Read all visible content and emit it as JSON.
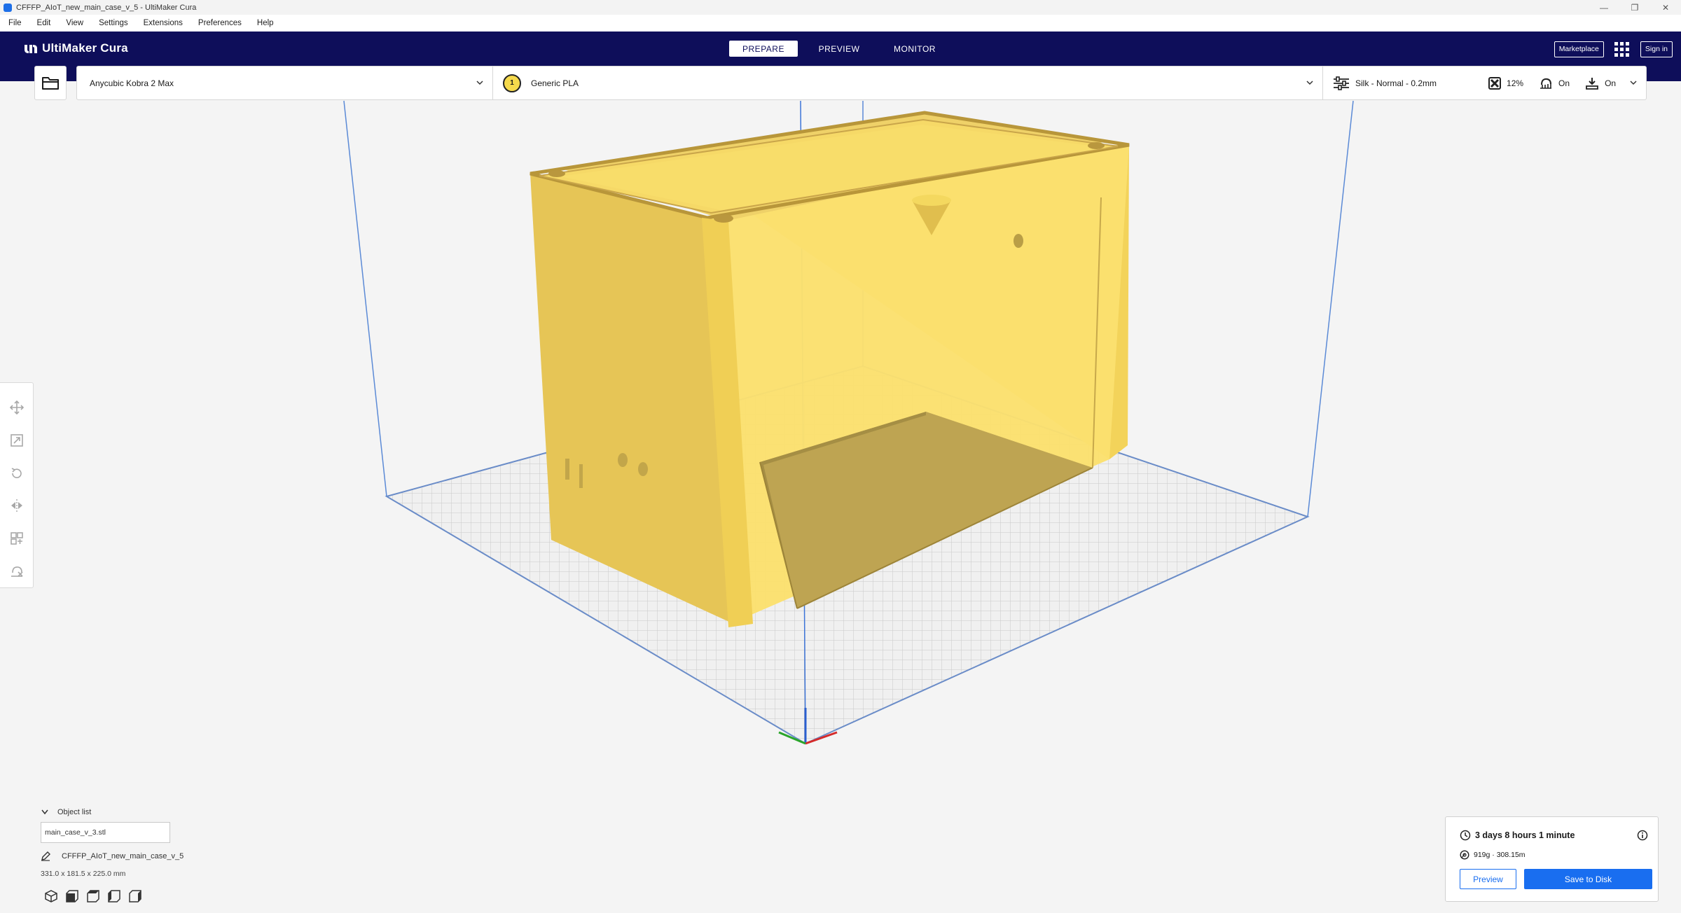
{
  "window": {
    "title": "CFFFP_AIoT_new_main_case_v_5 - UltiMaker Cura",
    "controls": [
      "—",
      "❐",
      "✕"
    ]
  },
  "menu": [
    "File",
    "Edit",
    "View",
    "Settings",
    "Extensions",
    "Preferences",
    "Help"
  ],
  "header": {
    "logo": "UltiMaker Cura",
    "stages": [
      "PREPARE",
      "PREVIEW",
      "MONITOR"
    ],
    "active_stage": "PREPARE",
    "marketplace": "Marketplace",
    "sign_in": "Sign in"
  },
  "config": {
    "printer": "Anycubic Kobra 2 Max",
    "extruder_number": "1",
    "material": "Generic PLA",
    "profile": "Silk - Normal - 0.2mm",
    "infill": "12%",
    "support": "On",
    "adhesion": "On"
  },
  "object_list": {
    "title": "Object list",
    "item": "main_case_v_3.stl",
    "project": "CFFFP_AIoT_new_main_case_v_5",
    "dimensions": "331.0 x 181.5 x 225.0 mm"
  },
  "print": {
    "time": "3 days 8 hours 1 minute",
    "material": "919g · 308.15m",
    "preview_label": "Preview",
    "save_label": "Save to Disk"
  },
  "colors": {
    "header_bg": "#0e0e5a",
    "accent": "#196ef0",
    "model": "#f5d94c"
  }
}
